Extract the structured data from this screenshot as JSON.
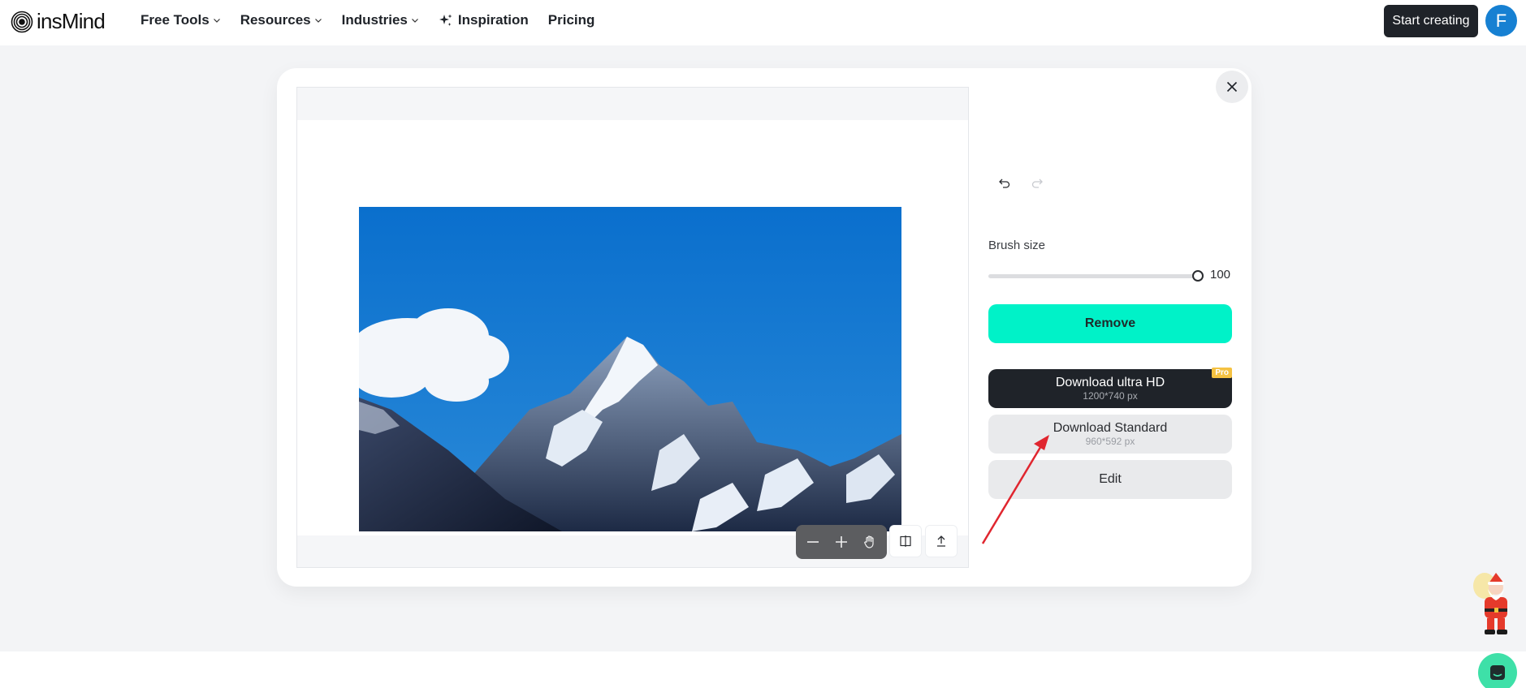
{
  "brand": {
    "name": "insMind"
  },
  "nav": {
    "items": [
      {
        "label": "Free Tools",
        "has_dropdown": true,
        "icon": null
      },
      {
        "label": "Resources",
        "has_dropdown": true,
        "icon": null
      },
      {
        "label": "Industries",
        "has_dropdown": true,
        "icon": null
      },
      {
        "label": "Inspiration",
        "has_dropdown": false,
        "icon": "sparkle-icon"
      },
      {
        "label": "Pricing",
        "has_dropdown": false,
        "icon": null
      }
    ],
    "cta_label": "Start creating",
    "avatar_initial": "F"
  },
  "editor": {
    "image_alt": "Snow-capped mountain peak under blue sky",
    "toolbar": {
      "zoom_out": "minus-icon",
      "zoom_in": "plus-icon",
      "pan": "hand-icon",
      "compare": "compare-icon",
      "upload": "upload-icon"
    }
  },
  "panel": {
    "brush_size_label": "Brush size",
    "brush_size_value": "100",
    "brush_size_fraction": 1.0,
    "remove_label": "Remove",
    "download_hd": {
      "label": "Download ultra HD",
      "size": "1200*740 px",
      "badge": "Pro"
    },
    "download_standard": {
      "label": "Download Standard",
      "size": "960*592 px"
    },
    "edit_label": "Edit"
  },
  "colors": {
    "accent_teal": "#00f2c8",
    "dark": "#1f2329",
    "avatar_blue": "#1680d2",
    "pro_badge": "#f5c242",
    "annotation_red": "#e0262f",
    "chat_green": "#3ee0a8"
  }
}
